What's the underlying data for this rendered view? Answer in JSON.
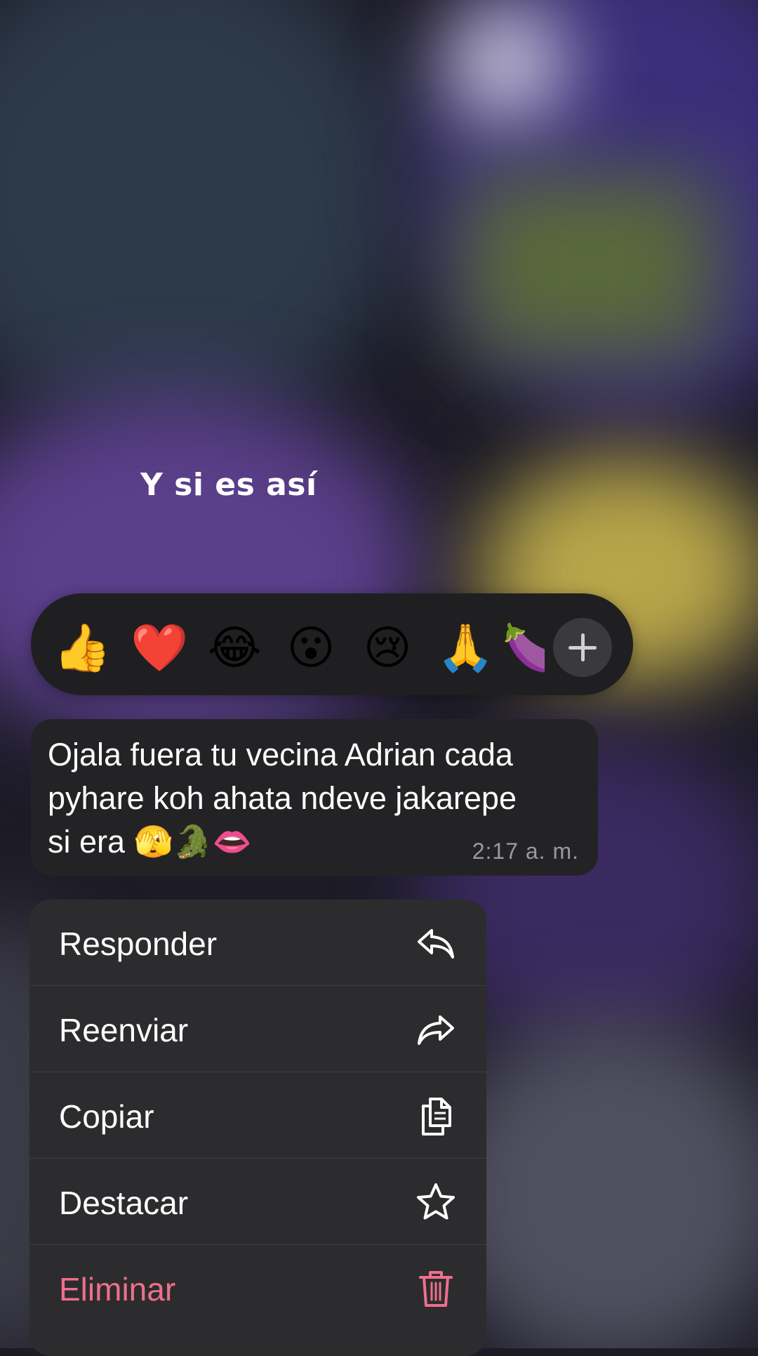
{
  "caption": {
    "text": "Y si es así"
  },
  "reaction_bar": {
    "emojis": [
      {
        "name": "thumbs-up-emoji",
        "glyph": "👍"
      },
      {
        "name": "red-heart-emoji",
        "glyph": "❤️"
      },
      {
        "name": "tears-of-joy-emoji",
        "glyph": "😂"
      },
      {
        "name": "surprised-face-emoji",
        "glyph": "😮"
      },
      {
        "name": "crying-face-emoji",
        "glyph": "😢"
      },
      {
        "name": "folded-hands-emoji",
        "glyph": "🙏"
      },
      {
        "name": "eggplant-emoji",
        "glyph": "🍆"
      }
    ],
    "add_icon": "plus-icon"
  },
  "message": {
    "text": "Ojala fuera tu vecina Adrian cada\npyhare koh ahata ndeve jakarepe\nsi era 🫣🐊👄",
    "time": "2:17 a. m."
  },
  "menu": {
    "items": [
      {
        "label": "Responder",
        "icon": "reply-icon"
      },
      {
        "label": "Reenviar",
        "icon": "forward-icon"
      },
      {
        "label": "Copiar",
        "icon": "copy-icon"
      },
      {
        "label": "Destacar",
        "icon": "star-icon"
      },
      {
        "label": "Eliminar",
        "icon": "trash-icon"
      }
    ]
  },
  "colors": {
    "accent_danger": "#ee6f8c",
    "menu_background": "#2c2c2e",
    "bubble_background": "#232325"
  }
}
